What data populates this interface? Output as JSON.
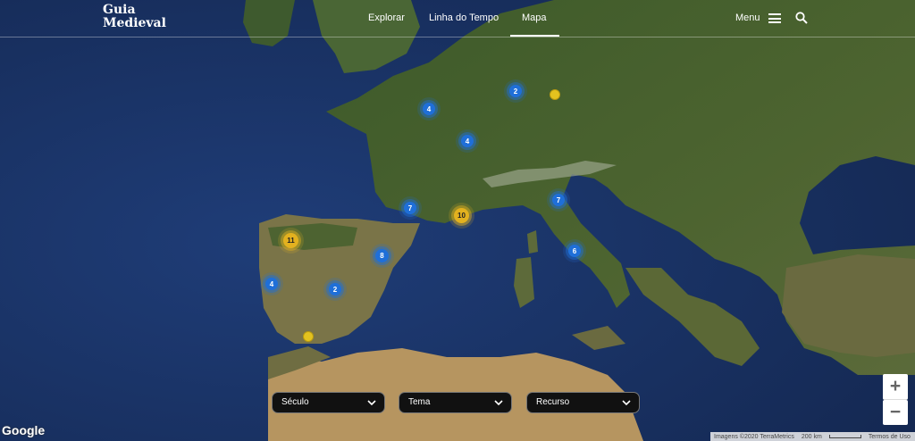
{
  "logo": {
    "line1": "Guia",
    "line2": "Medieval"
  },
  "nav": {
    "explore": "Explorar",
    "timeline": "Linha do Tempo",
    "map": "Mapa"
  },
  "menu": {
    "label": "Menu"
  },
  "markers": [
    "2",
    "4",
    "4",
    "7",
    "10",
    "7",
    "11",
    "8",
    "6",
    "4",
    "2"
  ],
  "filters": {
    "century": "Século",
    "theme": "Tema",
    "resource": "Recurso"
  },
  "zoom": {
    "in": "+",
    "out": "−"
  },
  "attribution": {
    "google": "Google",
    "imagery": "Imagens ©2020 TerraMetrics",
    "scale": "200 km",
    "terms": "Termos de Uso"
  },
  "colors": {
    "cluster_blue": "#1f6fd8",
    "cluster_gold": "#e3b11f",
    "sea": "#1c3566"
  }
}
